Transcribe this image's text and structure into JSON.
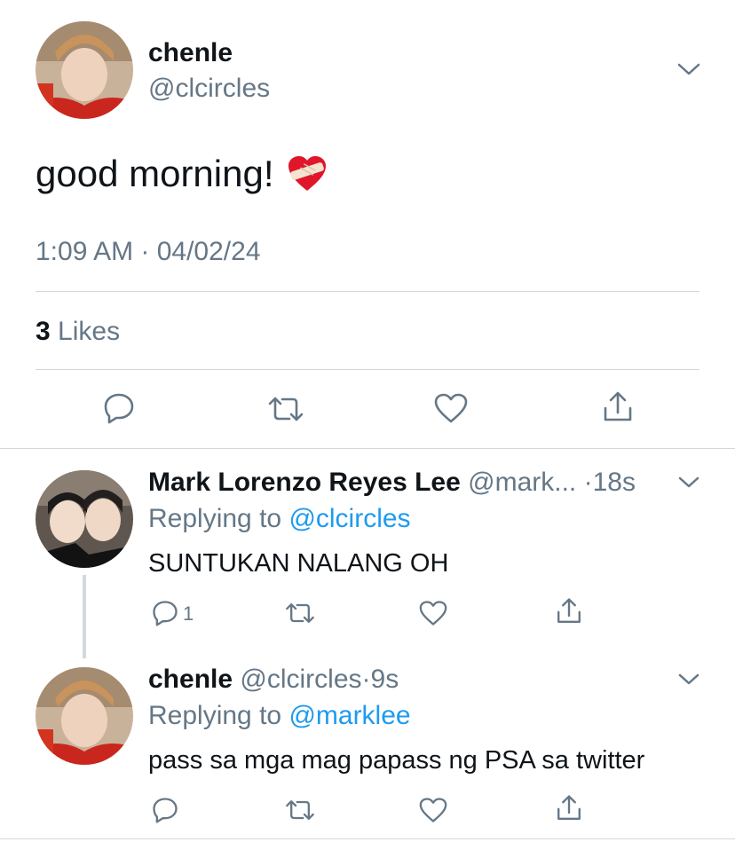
{
  "tweet": {
    "display_name": "chenle",
    "handle": "@clcircles",
    "text": "good morning!",
    "emoji": "heart-with-bandage",
    "timestamp": "1:09 AM · 04/02/24",
    "likes_count": "3",
    "likes_label": "Likes"
  },
  "replies": [
    {
      "display_name": "Mark Lorenzo Reyes Lee",
      "handle": "@mark...",
      "time": "·18s",
      "replying_prefix": "Replying to",
      "replying_to": "@clcircles",
      "text": "SUNTUKAN NALANG OH",
      "reply_count": "1"
    },
    {
      "display_name": "chenle",
      "handle": "@clcircles",
      "time": "·9s",
      "replying_prefix": "Replying to",
      "replying_to": "@marklee",
      "text": "pass sa mga mag papass ng PSA sa twitter"
    }
  ],
  "colors": {
    "text": "#0f1419",
    "secondary": "#657786",
    "link": "#1d9bf0",
    "divider": "#cfd9de",
    "thread_line": "#cfd9de"
  }
}
